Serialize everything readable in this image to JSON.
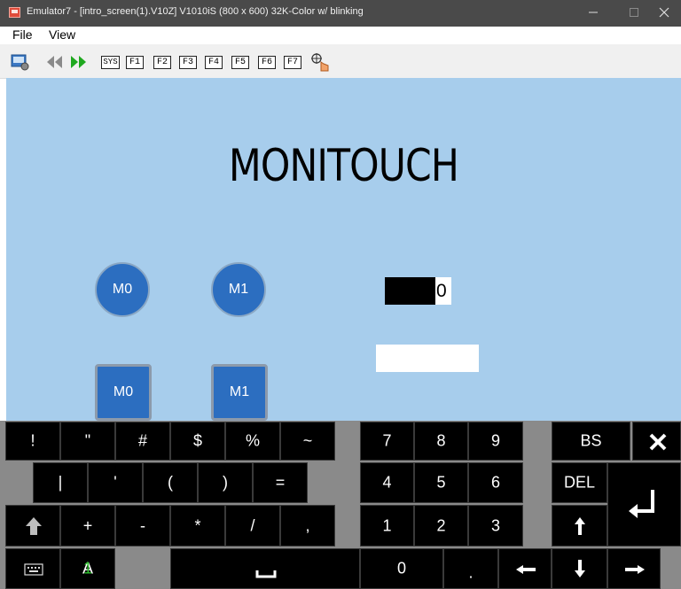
{
  "window": {
    "title": "Emulator7 - [intro_screen(1).V10Z] V1010iS (800 x 600) 32K-Color w/  blinking",
    "minimize_icon": "minimize-icon",
    "maximize_icon": "maximize-icon",
    "close_icon": "close-icon"
  },
  "menu": {
    "file": "File",
    "view": "View"
  },
  "toolbar": {
    "icons": [
      "screenshot-icon",
      "rewind-icon",
      "play-icon",
      "sys-icon",
      "touch-cursor-icon"
    ],
    "sys_label": "SYS",
    "fkeys": [
      "F1",
      "F2",
      "F3",
      "F4",
      "F5",
      "F6",
      "F7"
    ]
  },
  "screen": {
    "background": "#a7cdec",
    "brand_title": "MONITOUCH",
    "circle_buttons": [
      "M0",
      "M1"
    ],
    "square_buttons": [
      "M0",
      "M1"
    ],
    "numeric_value": "0",
    "text_field_value": ""
  },
  "keyboard": {
    "row1": [
      "!",
      "\"",
      "#",
      "$",
      "%",
      "~"
    ],
    "row2": [
      "|",
      "'",
      "(",
      ")",
      "="
    ],
    "row3_sym": [
      "+",
      "-",
      "*",
      "/",
      ","
    ],
    "digits_row1": [
      "7",
      "8",
      "9"
    ],
    "digits_row2": [
      "4",
      "5",
      "6"
    ],
    "digits_row3": [
      "1",
      "2",
      "3"
    ],
    "zero": "0",
    "dot": ".",
    "bs": "BS",
    "del": "DEL",
    "mode_label": "A",
    "mode_index": "1",
    "space_glyph": "␣",
    "colors": {
      "key_bg": "#000000",
      "key_text": "#ffffff",
      "mode_index": "#2ec02e",
      "panel": "#8a8a8a"
    }
  }
}
